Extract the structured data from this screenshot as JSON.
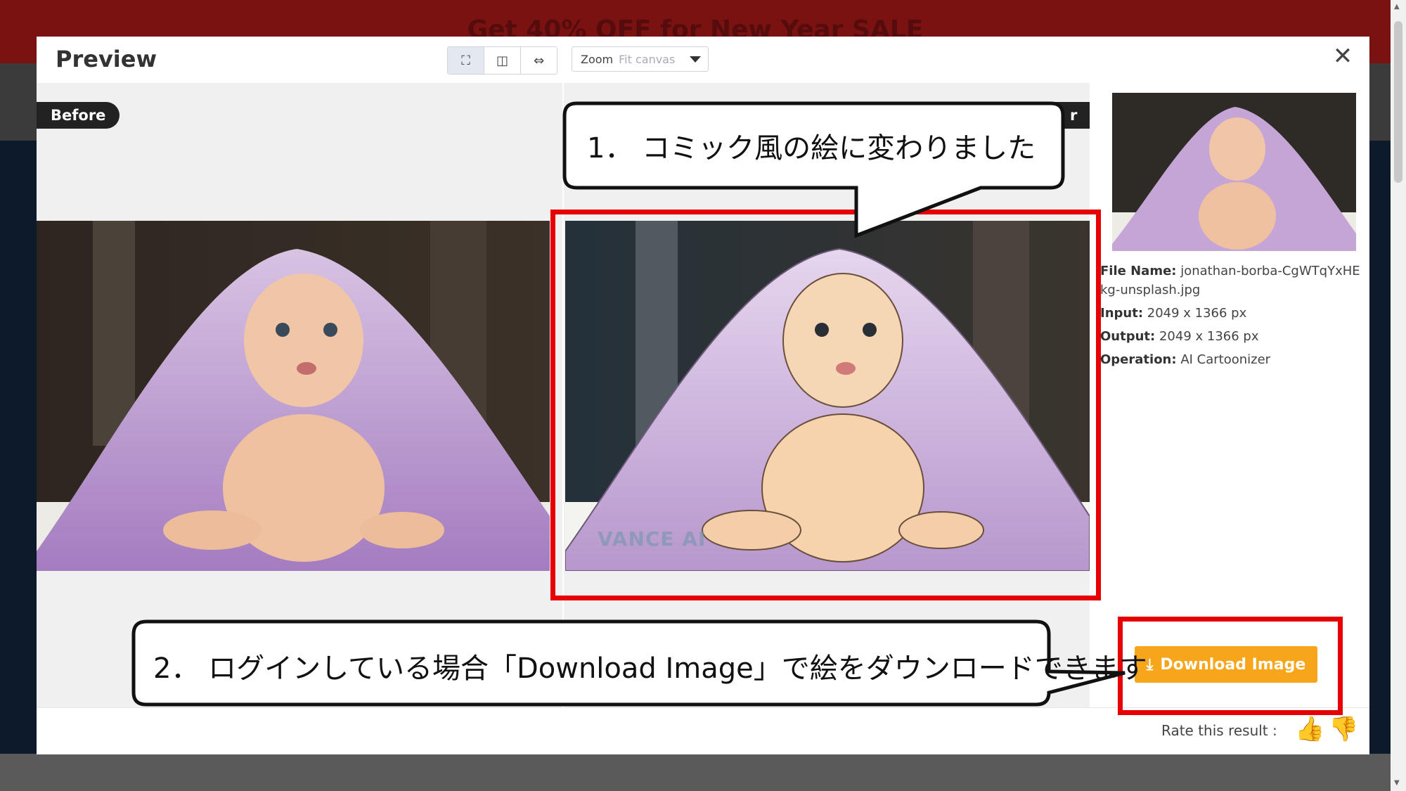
{
  "background": {
    "banner_text": "Get 40% OFF for New Year SALE"
  },
  "modal": {
    "title": "Preview",
    "view_modes": [
      {
        "icon": "fit-icon",
        "glyph": "⛶"
      },
      {
        "icon": "split-view-icon",
        "glyph": "◫"
      },
      {
        "icon": "compare-slider-icon",
        "glyph": "⇔"
      }
    ],
    "zoom": {
      "label": "Zoom",
      "value": "Fit canvas"
    },
    "close_glyph": "✕"
  },
  "canvas": {
    "before_label": "Before",
    "after_label": "r",
    "watermark": "VANCE AI"
  },
  "info": {
    "file_name_key": "File Name:",
    "file_name_value": "jonathan-borba-CgWTqYxHEkg-unsplash.jpg",
    "input_key": "Input:",
    "input_value": "2049 x 1366 px",
    "output_key": "Output:",
    "output_value": "2049 x 1366 px",
    "operation_key": "Operation:",
    "operation_value": "AI Cartoonizer"
  },
  "actions": {
    "download_label": "Download Image",
    "download_glyph": "⤓",
    "rate_label": "Rate this result :",
    "thumb_up_glyph": "👍",
    "thumb_down_glyph": "👎"
  },
  "annotations": {
    "callout_1": "1． コミック風の絵に変わりました",
    "callout_2": "2． ログインしている場合「Download Image」で絵をダウンロードできます"
  },
  "colors": {
    "accent": "#f7a51b",
    "highlight": "#e60000",
    "badge": "#222222"
  }
}
